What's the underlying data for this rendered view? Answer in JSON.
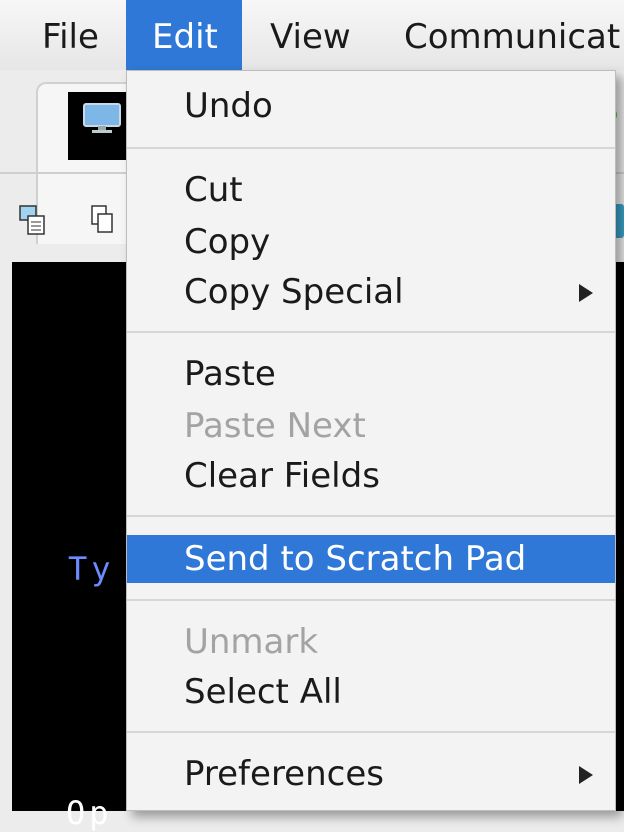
{
  "menubar": {
    "items": [
      "File",
      "Edit",
      "View",
      "Communicat"
    ]
  },
  "background": {
    "terminal_text_1": "Ty",
    "terminal_text_2": "Op"
  },
  "edit_menu": {
    "items": [
      {
        "label": "Undo",
        "enabled": true
      },
      {
        "label": "Cut",
        "enabled": true
      },
      {
        "label": "Copy",
        "enabled": true
      },
      {
        "label": "Copy Special",
        "enabled": true,
        "submenu": true
      },
      {
        "label": "Paste",
        "enabled": true
      },
      {
        "label": "Paste Next",
        "enabled": false
      },
      {
        "label": "Clear Fields",
        "enabled": true
      },
      {
        "label": "Send to Scratch Pad",
        "enabled": true,
        "selected": true
      },
      {
        "label": "Unmark",
        "enabled": false
      },
      {
        "label": "Select All",
        "enabled": true
      },
      {
        "label": "Preferences",
        "enabled": true,
        "submenu": true
      }
    ]
  },
  "colors": {
    "selection": "#2f78d7",
    "disabled_text": "#a3a3a3",
    "terminal_bg": "#000000",
    "terminal_blue": "#6b8cff"
  }
}
